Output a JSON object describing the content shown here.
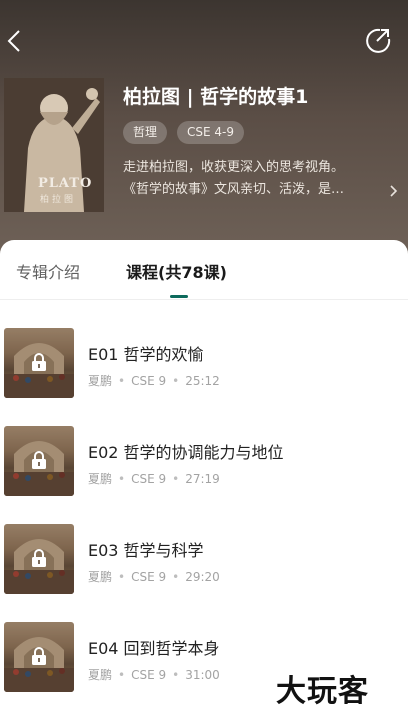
{
  "album": {
    "cover_title": "PLATO",
    "cover_subtitle": "柏拉图",
    "title": "柏拉图 | 哲学的故事1",
    "tags": [
      "哲理",
      "CSE 4-9"
    ],
    "description_line1": "走进柏拉图，收获更深入的思考视角。",
    "description_line2": "《哲学的故事》文风亲切、活泼，是…"
  },
  "tabs": {
    "intro": "专辑介绍",
    "courses": "课程(共78课)",
    "active": "courses"
  },
  "lessons": [
    {
      "title": "E01 哲学的欢愉",
      "author": "夏鹏",
      "level": "CSE 9",
      "duration": "25:12",
      "locked": true
    },
    {
      "title": "E02 哲学的协调能力与地位",
      "author": "夏鹏",
      "level": "CSE 9",
      "duration": "27:19",
      "locked": true
    },
    {
      "title": "E03 哲学与科学",
      "author": "夏鹏",
      "level": "CSE 9",
      "duration": "29:20",
      "locked": true
    },
    {
      "title": "E04 回到哲学本身",
      "author": "夏鹏",
      "level": "CSE 9",
      "duration": "31:00",
      "locked": true
    }
  ],
  "watermark": "大玩客",
  "icons": {
    "back": "chevron-left-icon",
    "share": "share-icon",
    "more": "chevron-right-icon",
    "lock": "lock-icon"
  },
  "colors": {
    "accent": "#0d6a5c",
    "header_bg": "#4e433b"
  }
}
